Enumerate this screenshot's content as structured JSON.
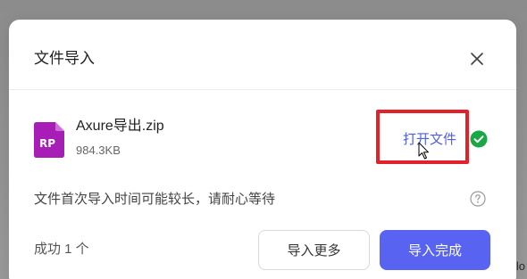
{
  "dialog": {
    "title": "文件导入",
    "close_icon": "close-icon"
  },
  "file": {
    "icon_label": "RP",
    "icon_color": "#a61eb5",
    "name": "Axure导出.zip",
    "size": "984.3KB",
    "open_label": "打开文件",
    "status_icon": "check-circle-icon",
    "status_color": "#1aa847"
  },
  "hint": {
    "text": "文件首次导入时间可能较长，请耐心等待",
    "help_icon": "question-circle-icon"
  },
  "footer": {
    "success_text": "成功 1 个",
    "import_more_label": "导入更多",
    "done_label": "导入完成",
    "primary_color": "#5863f1"
  },
  "background": {
    "peek_text": "lo"
  },
  "highlight_color": "#e2222a"
}
